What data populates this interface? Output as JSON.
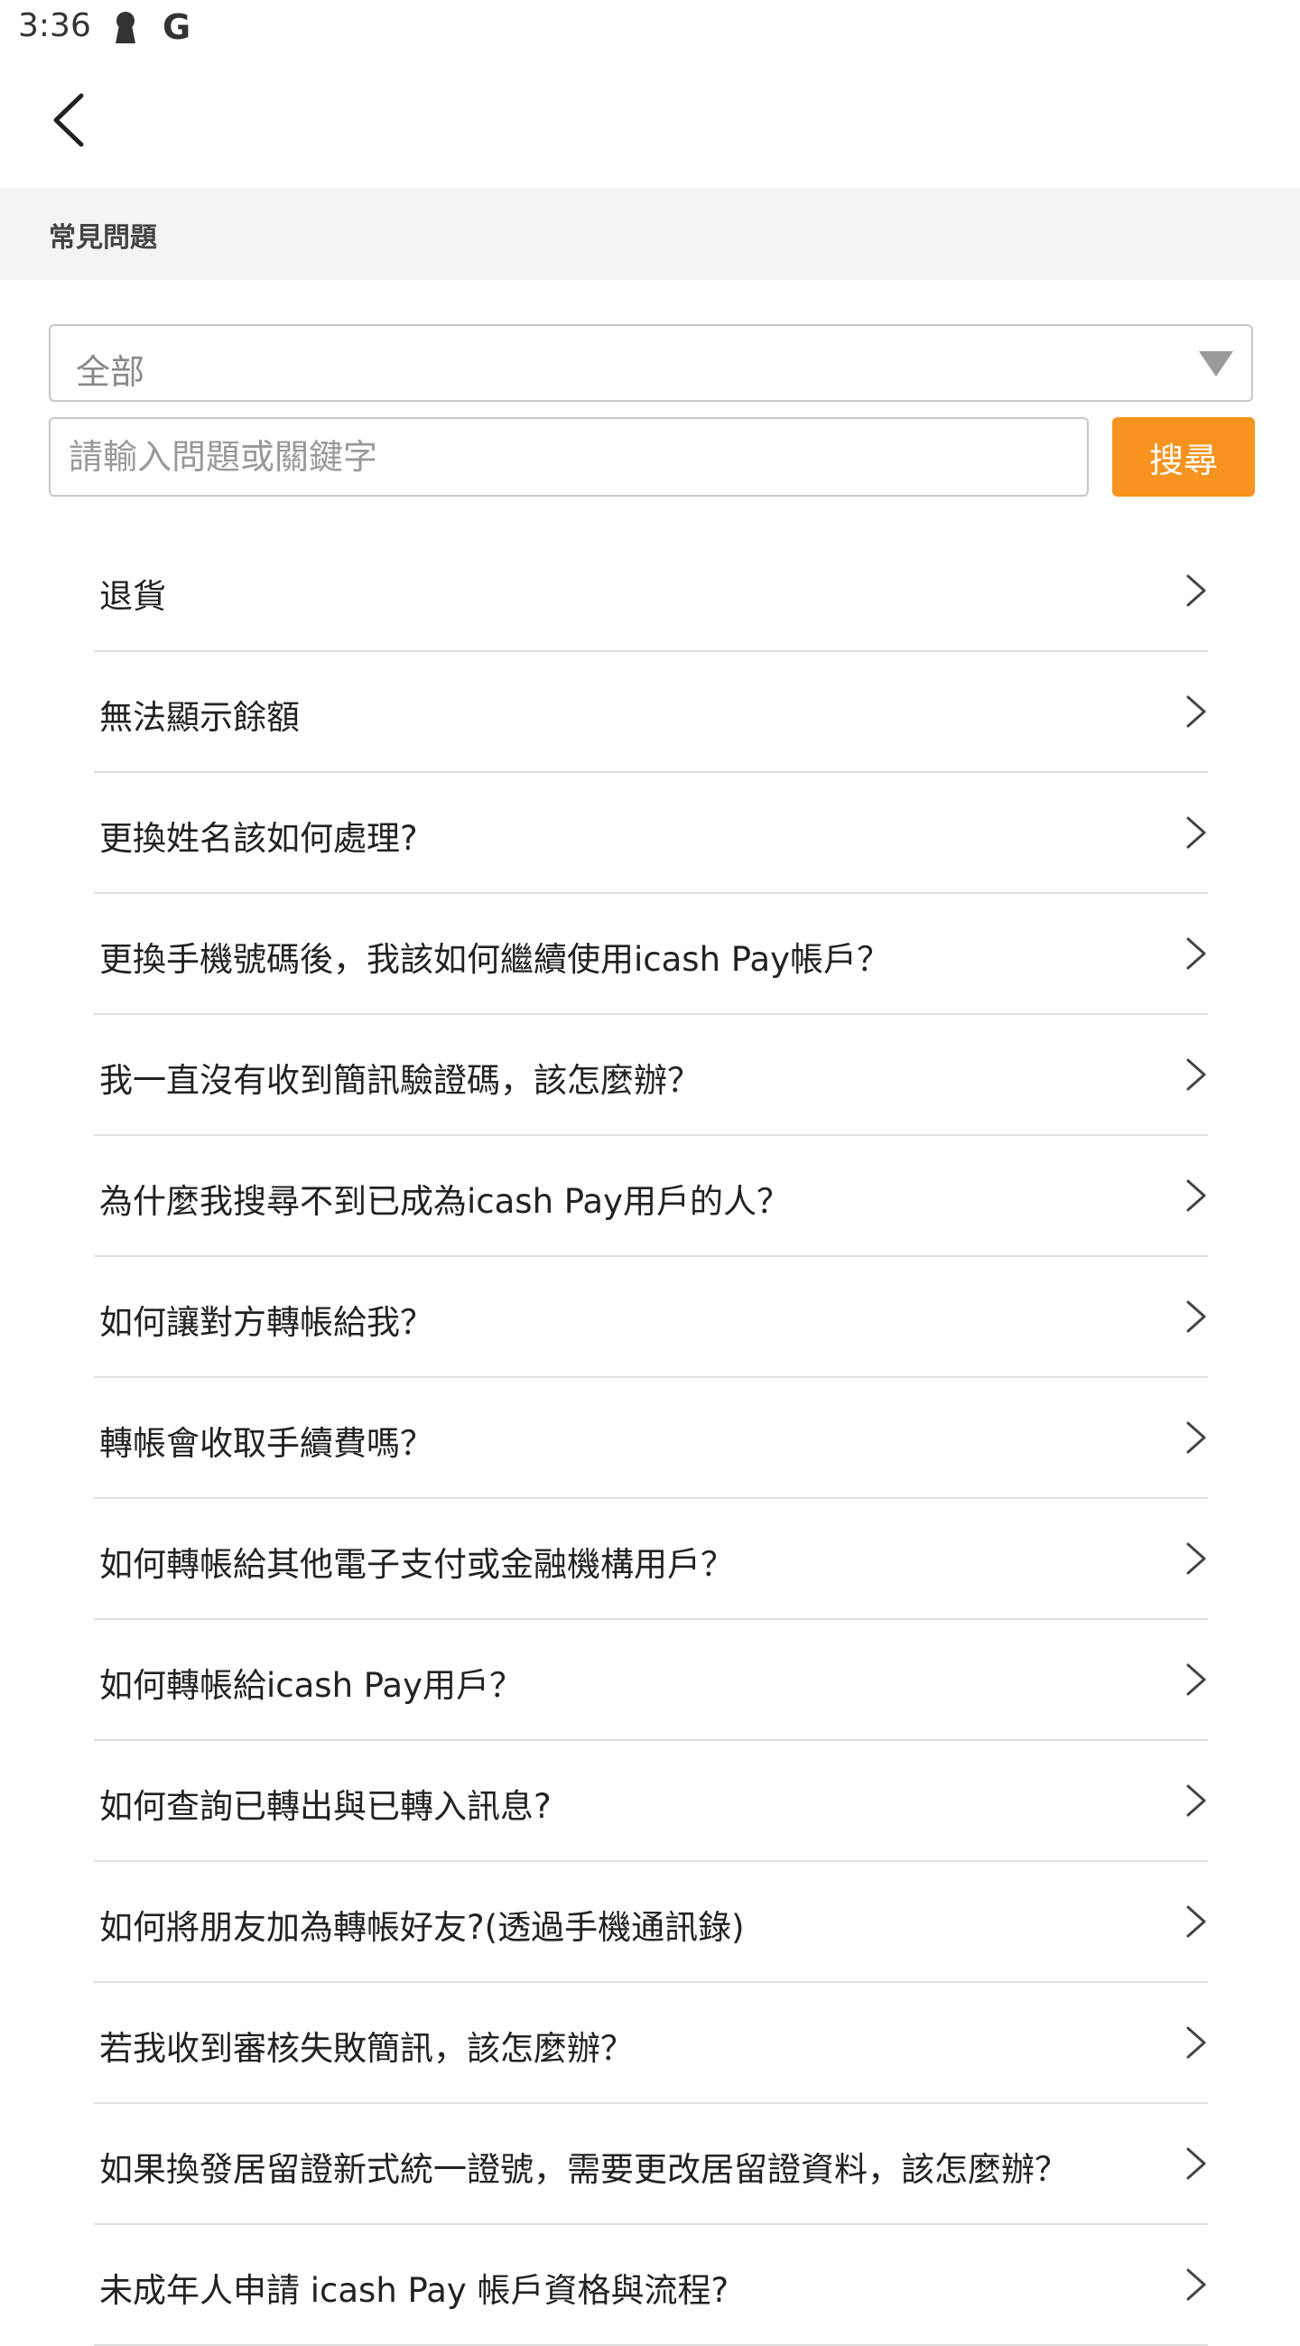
{
  "status_bar": {
    "time": "3:36",
    "icons": [
      "keyhole-icon",
      "google-g-icon"
    ],
    "g_glyph": "G"
  },
  "header": {
    "back_icon": "chevron-left-icon"
  },
  "section": {
    "title": "常見問題"
  },
  "filter": {
    "category_value": "全部",
    "dropdown_icon": "triangle-down-icon"
  },
  "search": {
    "placeholder": "請輸入問題或關鍵字",
    "value": "",
    "button_label": "搜尋",
    "button_color": "#f7931e"
  },
  "faq": {
    "item_icon": "chevron-right-icon",
    "items": [
      "退貨",
      "無法顯示餘額",
      "更換姓名該如何處理?",
      "更換手機號碼後，我該如何繼續使用icash Pay帳戶？",
      "我一直沒有收到簡訊驗證碼，該怎麼辦？",
      "為什麼我搜尋不到已成為icash Pay用戶的人？",
      "如何讓對方轉帳給我？",
      "轉帳會收取手續費嗎？",
      "如何轉帳給其他電子支付或金融機構用戶？",
      "如何轉帳給icash Pay用戶？",
      "如何查詢已轉出與已轉入訊息?",
      "如何將朋友加為轉帳好友?(透過手機通訊錄)",
      "若我收到審核失敗簡訊，該怎麼辦？",
      "如果換發居留證新式統一證號，需要更改居留證資料，該怎麼辦？",
      "未成年人申請 icash Pay 帳戶資格與流程?"
    ]
  }
}
